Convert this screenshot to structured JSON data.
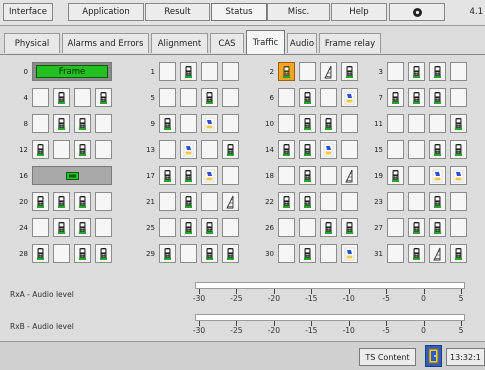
{
  "topmenu": [
    {
      "label": "Interface"
    },
    {
      "label": "Application"
    },
    {
      "label": "Result"
    },
    {
      "label": "Status",
      "active": true
    },
    {
      "label": "Misc."
    },
    {
      "label": "Help"
    },
    {
      "label": "",
      "icon": "settings-icon"
    },
    {
      "label": "4.1"
    }
  ],
  "subtabs": [
    {
      "label": "Physical"
    },
    {
      "label": "Alarms and Errors"
    },
    {
      "label": "Alignment"
    },
    {
      "label": "CAS"
    },
    {
      "label": "Traffic",
      "active": true
    },
    {
      "label": "Audio"
    },
    {
      "label": "Frame relay"
    }
  ],
  "colors": {
    "frame_green": "#22c020",
    "highlight_orange": "#f3a526",
    "status_blue": "#2b5fc5"
  },
  "timeslots": [
    {
      "num": "0",
      "special": "frame",
      "label": "Frame"
    },
    {
      "num": "1",
      "icons": [
        "",
        "phone-on-hook-icon",
        "",
        ""
      ]
    },
    {
      "num": "2",
      "icons": [
        "phone-off-hook-icon",
        "",
        "ringing-phone-icon",
        "phone-on-hook-icon"
      ],
      "highlight": [
        0
      ]
    },
    {
      "num": "3",
      "icons": [
        "",
        "phone-on-hook-icon",
        "phone-on-hook-icon",
        ""
      ]
    },
    {
      "num": "4",
      "icons": [
        "",
        "phone-on-hook-icon",
        "",
        "phone-on-hook-icon"
      ]
    },
    {
      "num": "5",
      "icons": [
        "",
        "",
        "phone-on-hook-icon",
        ""
      ]
    },
    {
      "num": "6",
      "icons": [
        "",
        "phone-on-hook-icon",
        "",
        "phone-dialing-icon"
      ]
    },
    {
      "num": "7",
      "icons": [
        "phone-on-hook-icon",
        "phone-on-hook-icon",
        "phone-on-hook-icon",
        ""
      ]
    },
    {
      "num": "8",
      "icons": [
        "",
        "phone-on-hook-icon",
        "phone-on-hook-icon",
        ""
      ]
    },
    {
      "num": "9",
      "icons": [
        "phone-on-hook-icon",
        "",
        "phone-dialing-icon",
        ""
      ]
    },
    {
      "num": "10",
      "icons": [
        "",
        "phone-on-hook-icon",
        "phone-on-hook-icon",
        ""
      ]
    },
    {
      "num": "11",
      "icons": [
        "",
        "",
        "",
        "phone-on-hook-icon"
      ]
    },
    {
      "num": "12",
      "icons": [
        "phone-on-hook-icon",
        "",
        "phone-on-hook-icon",
        ""
      ]
    },
    {
      "num": "13",
      "icons": [
        "",
        "phone-dialing-icon",
        "",
        "phone-on-hook-icon"
      ]
    },
    {
      "num": "14",
      "icons": [
        "phone-on-hook-icon",
        "phone-on-hook-icon",
        "phone-dialing-icon",
        ""
      ]
    },
    {
      "num": "15",
      "icons": [
        "",
        "",
        "phone-on-hook-icon",
        "phone-on-hook-icon"
      ]
    },
    {
      "num": "16",
      "special": "signalling"
    },
    {
      "num": "17",
      "icons": [
        "phone-on-hook-icon",
        "phone-on-hook-icon",
        "phone-dialing-icon",
        ""
      ]
    },
    {
      "num": "18",
      "icons": [
        "",
        "phone-on-hook-icon",
        "",
        "ringing-phone-icon"
      ]
    },
    {
      "num": "19",
      "icons": [
        "phone-on-hook-icon",
        "",
        "phone-dialing-icon",
        "phone-dialing-icon"
      ]
    },
    {
      "num": "20",
      "icons": [
        "phone-on-hook-icon",
        "phone-on-hook-icon",
        "phone-on-hook-icon",
        ""
      ]
    },
    {
      "num": "21",
      "icons": [
        "",
        "phone-on-hook-icon",
        "",
        "ringing-phone-icon"
      ]
    },
    {
      "num": "22",
      "icons": [
        "phone-on-hook-icon",
        "phone-on-hook-icon",
        "",
        ""
      ]
    },
    {
      "num": "23",
      "icons": [
        "",
        "",
        "phone-on-hook-icon",
        ""
      ]
    },
    {
      "num": "24",
      "icons": [
        "",
        "phone-on-hook-icon",
        "phone-on-hook-icon",
        ""
      ]
    },
    {
      "num": "25",
      "icons": [
        "",
        "phone-on-hook-icon",
        "phone-on-hook-icon",
        ""
      ]
    },
    {
      "num": "26",
      "icons": [
        "",
        "",
        "phone-on-hook-icon",
        "phone-on-hook-icon"
      ]
    },
    {
      "num": "27",
      "icons": [
        "",
        "phone-on-hook-icon",
        "phone-on-hook-icon",
        ""
      ]
    },
    {
      "num": "28",
      "icons": [
        "phone-on-hook-icon",
        "",
        "phone-on-hook-icon",
        "phone-on-hook-icon"
      ]
    },
    {
      "num": "29",
      "icons": [
        "phone-on-hook-icon",
        "",
        "phone-on-hook-icon",
        "phone-on-hook-icon"
      ]
    },
    {
      "num": "30",
      "icons": [
        "",
        "phone-on-hook-icon",
        "",
        "phone-dialing-icon"
      ]
    },
    {
      "num": "31",
      "icons": [
        "",
        "phone-on-hook-icon",
        "ringing-phone-icon",
        "phone-on-hook-icon"
      ]
    }
  ],
  "audio": {
    "rxa_label": "RxA - Audio level",
    "rxb_label": "RxB - Audio level",
    "scale_ticks": [
      "-30",
      "-25",
      "-20",
      "-15",
      "-10",
      "-5",
      "0",
      "5"
    ]
  },
  "footer": {
    "ts_content_label": "TS Content",
    "status_icon": "door-exit-icon",
    "time": "13:32:1"
  }
}
